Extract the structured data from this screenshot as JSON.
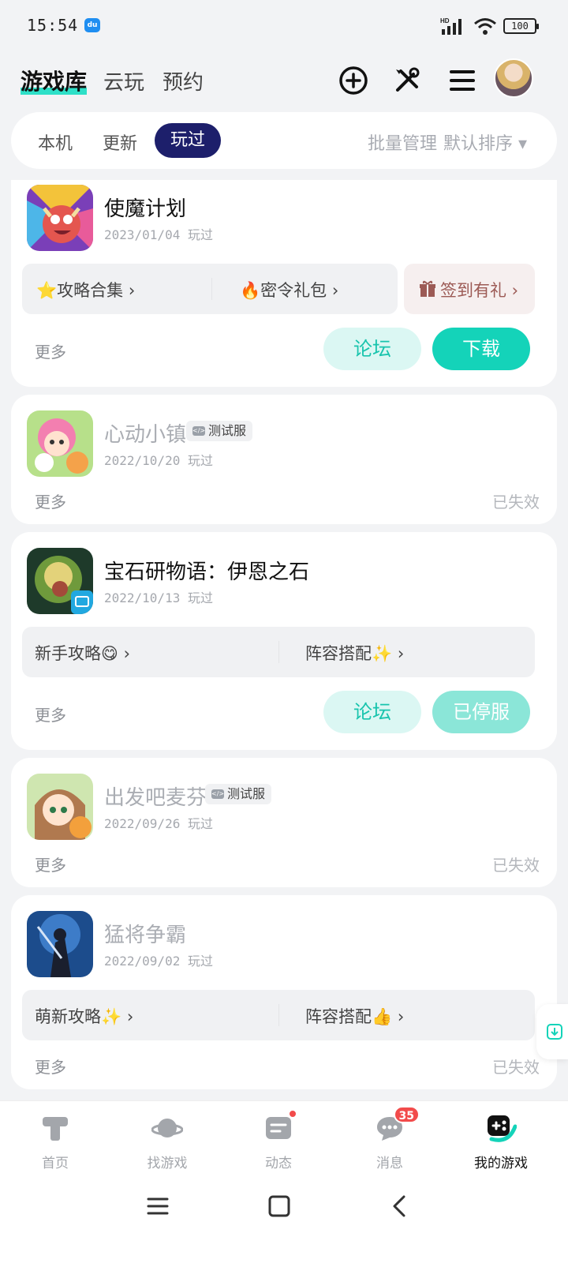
{
  "status_bar": {
    "time": "15:54",
    "app_icon_text": "du",
    "hd": "HD",
    "battery": "100"
  },
  "header": {
    "tab_library": "游戏库",
    "tab_cloud": "云玩",
    "tab_reserve": "预约",
    "icons": [
      "add-circle-icon",
      "tools-icon",
      "menu-icon"
    ]
  },
  "filter": {
    "tab_local": "本机",
    "tab_update": "更新",
    "tab_played": "玩过",
    "batch": "批量管理",
    "sort": "默认排序 ▾"
  },
  "games": [
    {
      "name": "使魔计划",
      "date": "2023/01/04",
      "played": "玩过",
      "guide1": "⭐攻略合集 ›",
      "guide2": "🔥密令礼包 ›",
      "gift": "签到有礼 ›",
      "more": "更多",
      "forum": "论坛",
      "action": "下载"
    },
    {
      "name": "心动小镇",
      "badge": "测试服",
      "date": "2022/10/20",
      "played": "玩过",
      "more": "更多",
      "status": "已失效"
    },
    {
      "name": "宝石研物语：伊恩之石",
      "date": "2022/10/13",
      "played": "玩过",
      "guide1": "新手攻略😋 ›",
      "guide2": "阵容搭配✨ ›",
      "more": "更多",
      "forum": "论坛",
      "action": "已停服"
    },
    {
      "name": "出发吧麦芬",
      "badge": "测试服",
      "date": "2022/09/26",
      "played": "玩过",
      "more": "更多",
      "status": "已失效"
    },
    {
      "name": "猛将争霸",
      "date": "2022/09/02",
      "played": "玩过",
      "guide1": "萌新攻略✨ ›",
      "guide2": "阵容搭配👍 ›",
      "more": "更多",
      "status": "已失效"
    }
  ],
  "bottom_nav": {
    "home": "首页",
    "discover": "找游戏",
    "feed": "动态",
    "messages": "消息",
    "messages_count": "35",
    "mygames": "我的游戏"
  },
  "colors": {
    "accent": "#14d3b9",
    "active_tab": "#1d1f6b",
    "badge_red": "#f24b4b"
  }
}
